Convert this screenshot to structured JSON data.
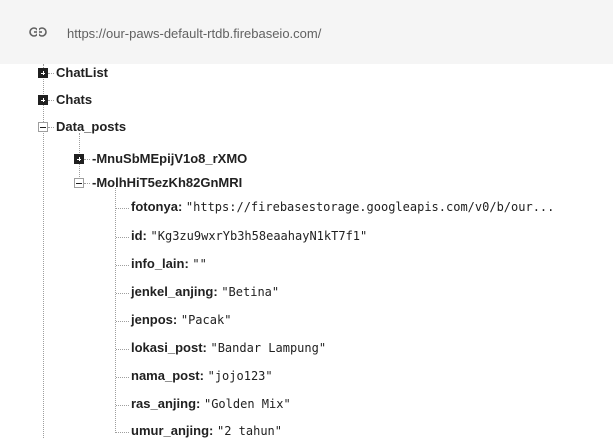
{
  "header": {
    "url": "https://our-paws-default-rtdb.firebaseio.com/",
    "link_icon": "link-icon"
  },
  "tree": {
    "chatlist": "ChatList",
    "chats": "Chats",
    "data_posts": "Data_posts",
    "post1": "-MnuSbMEpijV1o8_rXMO",
    "post2": "-MolhHiT5ezKh82GnMRI",
    "fields": [
      {
        "key": "fotonya:",
        "value": "\"https://firebasestorage.googleapis.com/v0/b/our..."
      },
      {
        "key": "id:",
        "value": "\"Kg3zu9wxrYb3h58eaahayN1kT7f1\""
      },
      {
        "key": "info_lain:",
        "value": "\"\""
      },
      {
        "key": "jenkel_anjing:",
        "value": "\"Betina\""
      },
      {
        "key": "jenpos:",
        "value": "\"Pacak\""
      },
      {
        "key": "lokasi_post:",
        "value": "\"Bandar Lampung\""
      },
      {
        "key": "nama_post:",
        "value": "\"jojo123\""
      },
      {
        "key": "ras_anjing:",
        "value": "\"Golden Mix\""
      },
      {
        "key": "umur_anjing:",
        "value": "\"2 tahun\""
      }
    ]
  }
}
